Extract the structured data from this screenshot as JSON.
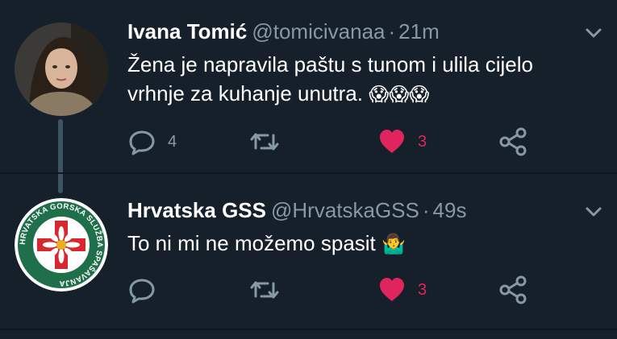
{
  "colors": {
    "background": "#15202b",
    "secondary_text": "#8899a6",
    "like_red": "#e0245e"
  },
  "tweets": [
    {
      "display_name": "Ivana Tomić",
      "handle": "@tomicivanaa",
      "separator": "·",
      "time": "21m",
      "text": "Žena je napravila paštu s tunom i ulila cijelo vrhnje za kuhanje unutra.",
      "emoji": "😱😱😱",
      "reply_count": "4",
      "like_count": "3",
      "liked": true,
      "avatar_icon": "person-photo-avatar"
    },
    {
      "display_name": "Hrvatska GSS",
      "handle": "@HrvatskaGSS",
      "separator": "·",
      "time": "49s",
      "text": "To ni mi ne možemo spasit",
      "emoji": "🤷‍♂️",
      "reply_count": "",
      "like_count": "3",
      "liked": true,
      "avatar_icon": "edelweiss-logo",
      "logo_text": "HRVATSKA GORSKA SLUŽBA SPAŠAVANJA"
    }
  ]
}
